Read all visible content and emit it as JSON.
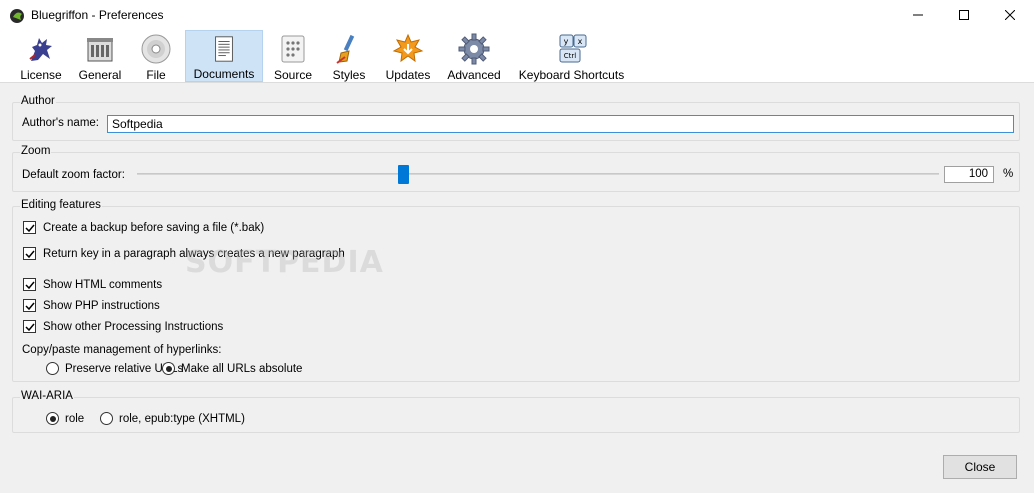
{
  "window": {
    "title": "Bluegriffon - Preferences"
  },
  "toolbar": {
    "items": [
      {
        "label": "License",
        "icon": "griffin-icon"
      },
      {
        "label": "General",
        "icon": "building-icon"
      },
      {
        "label": "File",
        "icon": "disc-icon"
      },
      {
        "label": "Documents",
        "icon": "document-icon",
        "selected": true
      },
      {
        "label": "Source",
        "icon": "dots-page-icon"
      },
      {
        "label": "Styles",
        "icon": "paint-brush-icon"
      },
      {
        "label": "Updates",
        "icon": "updates-icon"
      },
      {
        "label": "Advanced",
        "icon": "gear-icon"
      },
      {
        "label": "Keyboard Shortcuts",
        "icon": "keyboard-icon"
      }
    ],
    "keyboard_keys": [
      "y",
      "x",
      "Ctrl"
    ]
  },
  "author": {
    "title": "Author",
    "name_label": "Author's name:",
    "name_value": "Softpedia"
  },
  "zoom": {
    "title": "Zoom",
    "factor_label": "Default zoom factor:",
    "value": "100",
    "unit": "%"
  },
  "editing": {
    "title": "Editing features",
    "checkboxes": [
      {
        "label": "Create a backup before saving a file (*.bak)",
        "checked": true
      },
      {
        "label": "Return key in a paragraph always creates a new paragraph",
        "checked": true
      },
      {
        "label": "Show HTML comments",
        "checked": true
      },
      {
        "label": "Show PHP instructions",
        "checked": true
      },
      {
        "label": "Show other Processing Instructions",
        "checked": true
      }
    ],
    "hyperlinks_label": "Copy/paste management of hyperlinks:",
    "hyperlink_options": [
      {
        "label": "Preserve relative URLs",
        "selected": false
      },
      {
        "label": "Make all URLs absolute",
        "selected": true
      }
    ]
  },
  "wai_aria": {
    "title": "WAI-ARIA",
    "options": [
      {
        "label": "role",
        "selected": true
      },
      {
        "label": "role, epub:type (XHTML)",
        "selected": false
      }
    ]
  },
  "buttons": {
    "close": "Close"
  },
  "watermark": "SOFTPEDIA",
  "colors": {
    "accent": "#0078d7",
    "selected_tab": "#cfe3f7"
  }
}
